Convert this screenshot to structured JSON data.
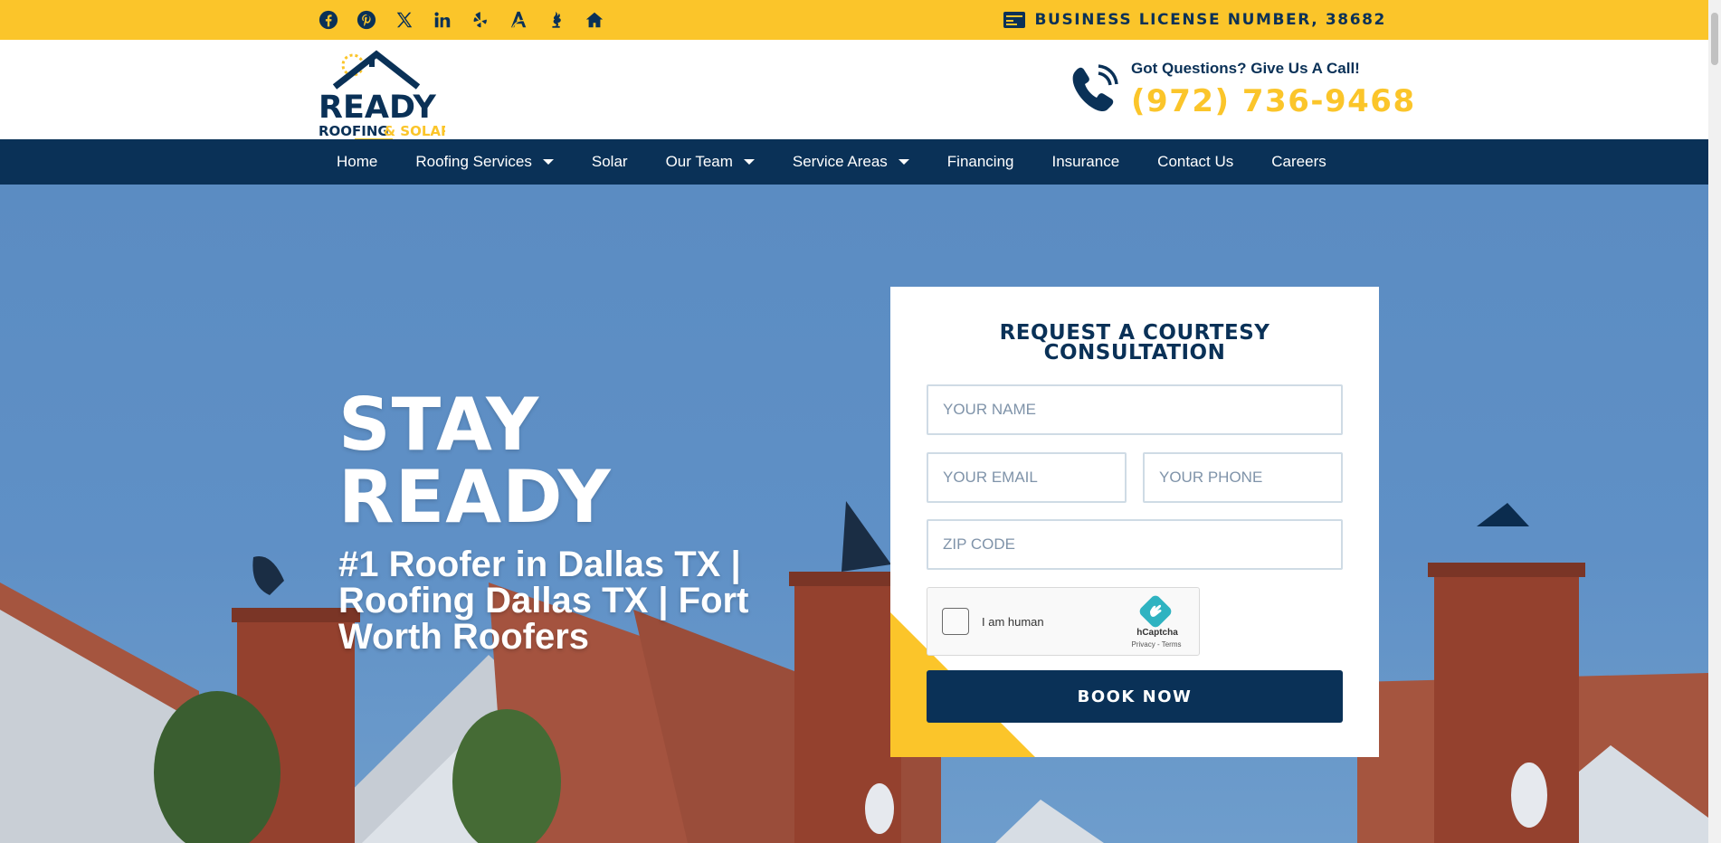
{
  "topbar": {
    "social_icons": [
      "facebook-icon",
      "pinterest-icon",
      "x-icon",
      "linkedin-icon",
      "yelp-icon",
      "angi-icon",
      "bbb-icon",
      "home-icon"
    ],
    "license_text": "BUSINESS LICENSE NUMBER, 38682",
    "colors": {
      "bar": "#fbc52a",
      "icon": "#0a3157"
    }
  },
  "header": {
    "logo": {
      "line1": "READY",
      "line2a": "ROOFING",
      "line2b": "& SOLAR"
    },
    "call_prompt": "Got Questions? Give Us A Call!",
    "phone": "(972) 736-9468"
  },
  "nav": {
    "items": [
      {
        "label": "Home",
        "dropdown": false
      },
      {
        "label": "Roofing Services",
        "dropdown": true
      },
      {
        "label": "Solar",
        "dropdown": false
      },
      {
        "label": "Our Team",
        "dropdown": true
      },
      {
        "label": "Service Areas",
        "dropdown": true
      },
      {
        "label": "Financing",
        "dropdown": false
      },
      {
        "label": "Insurance",
        "dropdown": false
      },
      {
        "label": "Contact Us",
        "dropdown": false
      },
      {
        "label": "Careers",
        "dropdown": false
      }
    ],
    "color": "#0a3157"
  },
  "hero": {
    "headline_line1": "STAY",
    "headline_line2": "READY",
    "subhead": "#1 Roofer in Dallas TX | Roofing Dallas TX | Fort Worth Roofers"
  },
  "form": {
    "title_line1": "REQUEST A COURTESY",
    "title_line2": "CONSULTATION",
    "name_placeholder": "YOUR NAME",
    "email_placeholder": "YOUR EMAIL",
    "phone_placeholder": "YOUR PHONE",
    "zip_placeholder": "ZIP CODE",
    "captcha_label": "I am human",
    "captcha_brand": "hCaptcha",
    "captcha_links": "Privacy - Terms",
    "submit_label": "BOOK NOW"
  }
}
